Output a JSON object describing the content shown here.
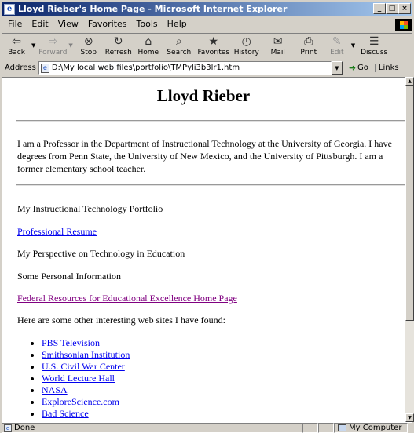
{
  "window": {
    "title": "Lloyd Rieber's Home Page - Microsoft Internet Explorer",
    "min": "_",
    "max": "□",
    "close": "×"
  },
  "menu": [
    "File",
    "Edit",
    "View",
    "Favorites",
    "Tools",
    "Help"
  ],
  "toolbar": {
    "back": "Back",
    "forward": "Forward",
    "stop": "Stop",
    "refresh": "Refresh",
    "home": "Home",
    "search": "Search",
    "favorites": "Favorites",
    "history": "History",
    "mail": "Mail",
    "print": "Print",
    "edit": "Edit",
    "discuss": "Discuss"
  },
  "address": {
    "label": "Address",
    "value": "D:\\My local web files\\portfolio\\TMPyli3b3lr1.htm",
    "go": "Go",
    "links": "Links"
  },
  "page": {
    "heading": "Lloyd Rieber",
    "intro": "I am a Professor in the Department of Instructional Technology at the University of Georgia. I have degrees from Penn State, the University of New Mexico, and the University of Pittsburgh. I am a former elementary school teacher.",
    "portfolio": "My Instructional Technology Portfolio",
    "resume_link": "Professional Resume",
    "perspective": "My Perspective on Technology in Education",
    "personal": "Some Personal Information",
    "federal_link": "Federal Resources for Educational Excellence Home Page",
    "sites_intro": "Here are some other interesting web sites I have found:",
    "sites": [
      "PBS Television",
      "Smithsonian Institution",
      "U.S. Civil War Center",
      "World Lecture Hall",
      "NASA",
      "ExploreScience.com",
      "Bad Science"
    ]
  },
  "status": {
    "text": "Done",
    "zone": "My Computer"
  }
}
